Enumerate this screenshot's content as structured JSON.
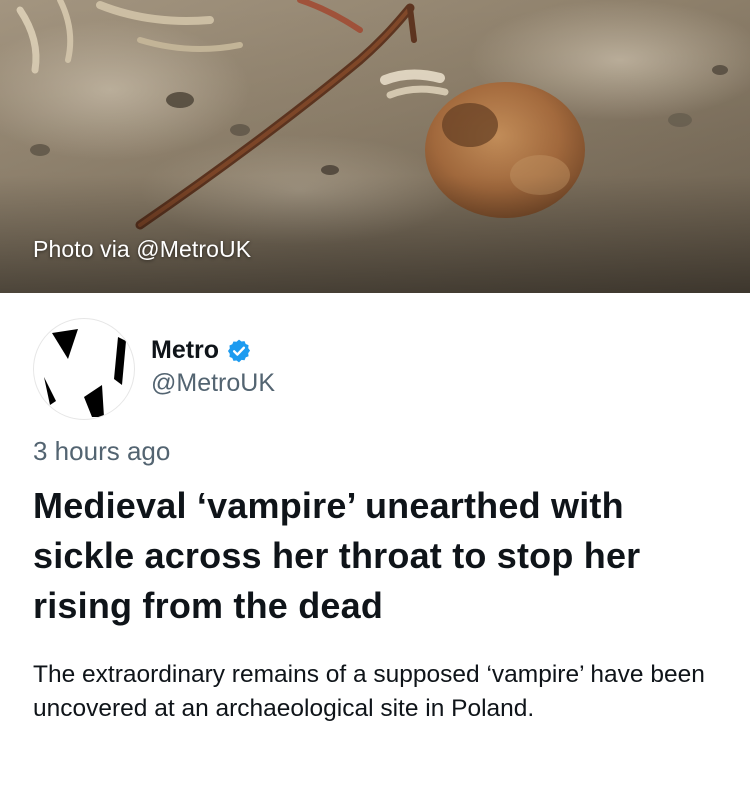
{
  "photo": {
    "caption": "Photo via @MetroUK"
  },
  "author": {
    "display_name": "Metro",
    "handle": "@MetroUK",
    "verified_icon": "verified-badge-icon",
    "avatar_icon": "metro-logo-icon"
  },
  "post": {
    "timestamp": "3 hours ago",
    "headline": "Medieval ‘vampire’ unearthed with sickle across her throat to stop her rising from the dead",
    "description": "The extraordinary remains of a supposed ‘vampire’ have been uncovered at an archaeological site in Poland."
  },
  "colors": {
    "text_primary": "#0f1419",
    "text_secondary": "#536471",
    "verified_blue": "#1d9bf0",
    "photo_soil": "#8a7c68"
  }
}
